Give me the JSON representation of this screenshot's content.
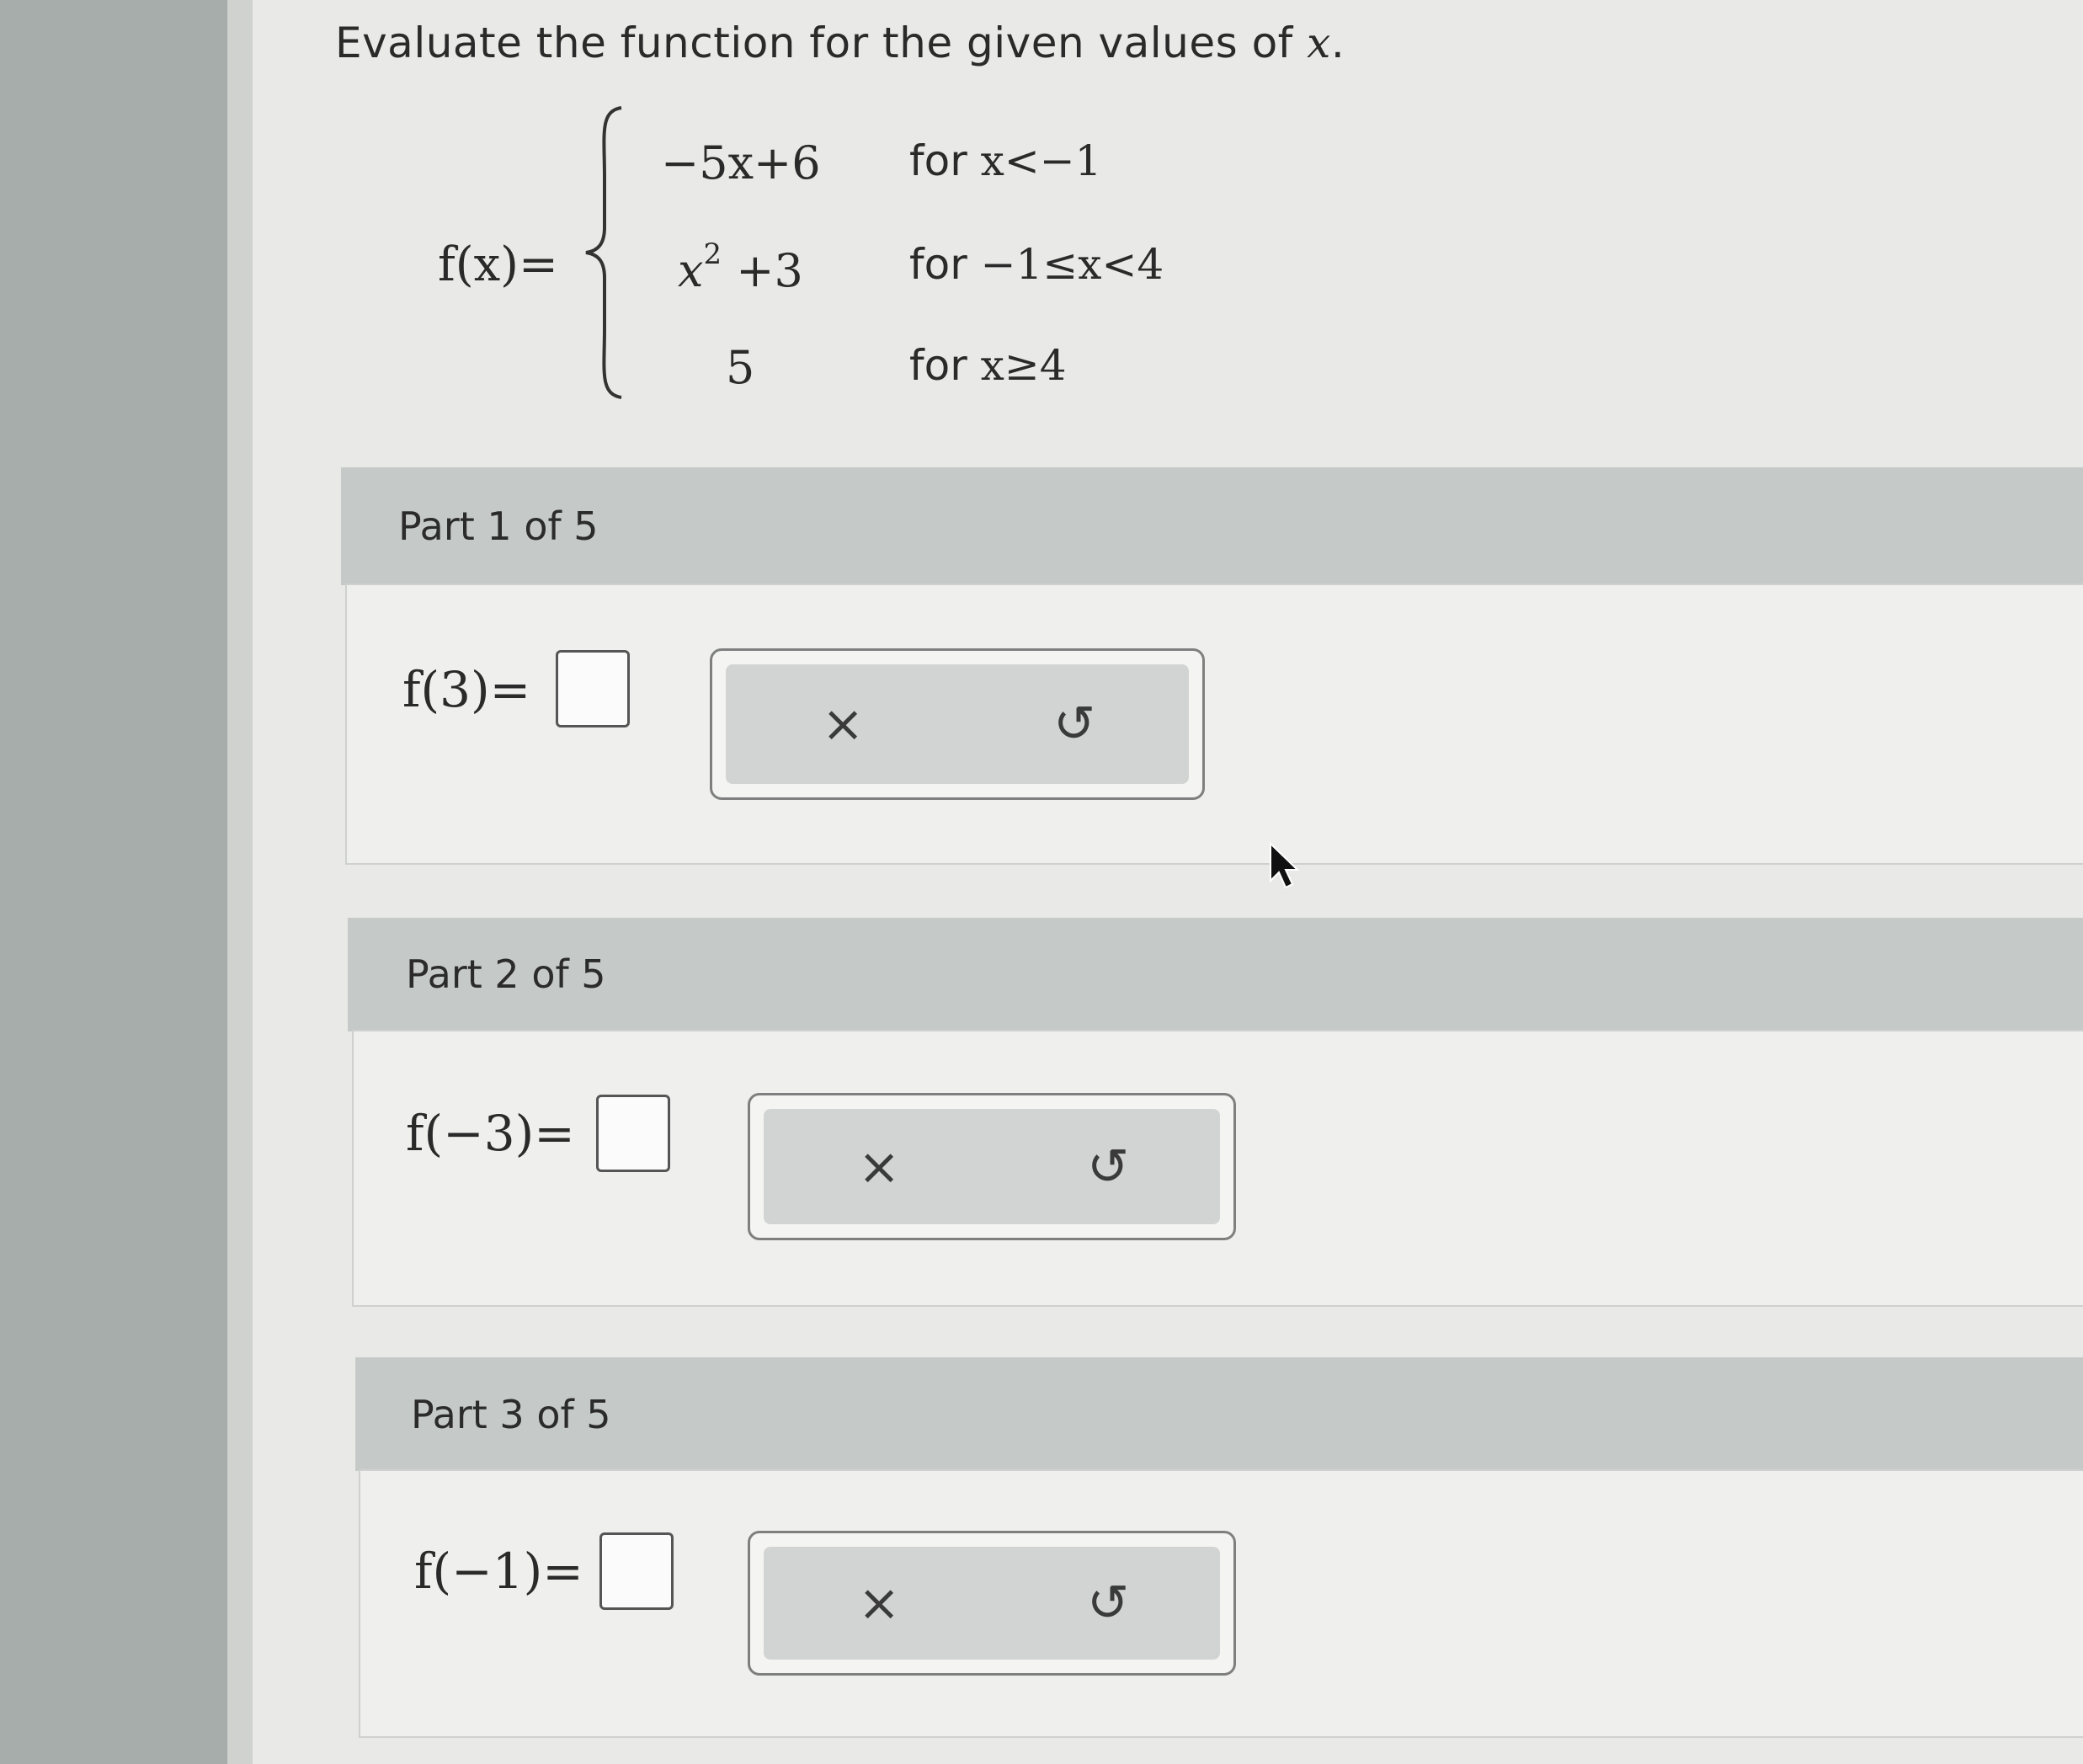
{
  "instruction": {
    "text": "Evaluate the function for the given values of ",
    "var": "x",
    "period": "."
  },
  "function": {
    "lhs": "f(x)=",
    "cases": [
      {
        "expr": "−5x+6",
        "cond_word": "for",
        "cond": "x<−1"
      },
      {
        "expr_base": "x",
        "expr_exp": "2",
        "expr_rest": " +3",
        "cond_word": "for",
        "cond": "−1≤x<4"
      },
      {
        "expr": "5",
        "cond_word": "for",
        "cond": "x≥4"
      }
    ]
  },
  "parts": [
    {
      "title": "Part 1 of 5",
      "label": "f(3)=",
      "answer": "",
      "clear_icon": "×",
      "undo_icon": "↺"
    },
    {
      "title": "Part 2 of 5",
      "label": "f(−3)=",
      "answer": "",
      "clear_icon": "×",
      "undo_icon": "↺"
    },
    {
      "title": "Part 3 of 5",
      "label": "f(−1)=",
      "answer": "",
      "clear_icon": "×",
      "undo_icon": "↺"
    }
  ]
}
